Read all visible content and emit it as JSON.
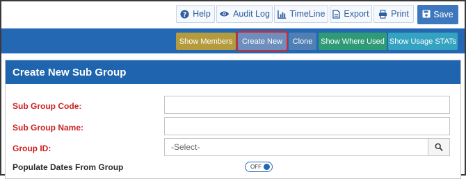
{
  "toolbar": {
    "help_label": "Help",
    "audit_label": "Audit Log",
    "timeline_label": "TimeLine",
    "export_label": "Export",
    "print_label": "Print",
    "save_label": "Save"
  },
  "actions": {
    "show_members": "Show Members",
    "create_new": "Create New",
    "clone": "Clone",
    "show_where_used": "Show Where Used",
    "show_usage_stats": "Show Usage STATs"
  },
  "form": {
    "title": "Create New Sub Group",
    "sub_group_code_label": "Sub Group Code:",
    "sub_group_code_value": "",
    "sub_group_name_label": "Sub Group Name:",
    "sub_group_name_value": "",
    "group_id_label": "Group ID:",
    "group_id_selected": "-Select-",
    "populate_dates_label": "Populate Dates From Group",
    "populate_dates_toggle": "OFF"
  },
  "colors": {
    "toolbar_text": "#2d5e9e",
    "save_bg": "#3d77bd",
    "action_band": "#2468b4",
    "show_members_bg": "#b49b3d",
    "create_new_bg": "#6e8fbd",
    "create_new_outline": "#d9262b",
    "clone_bg": "#4f7fb5",
    "show_where_used_bg": "#2e9a76",
    "show_usage_stats_bg": "#34a3c2",
    "panel_header": "#1f64ae",
    "required_label": "#cc1f1f"
  }
}
